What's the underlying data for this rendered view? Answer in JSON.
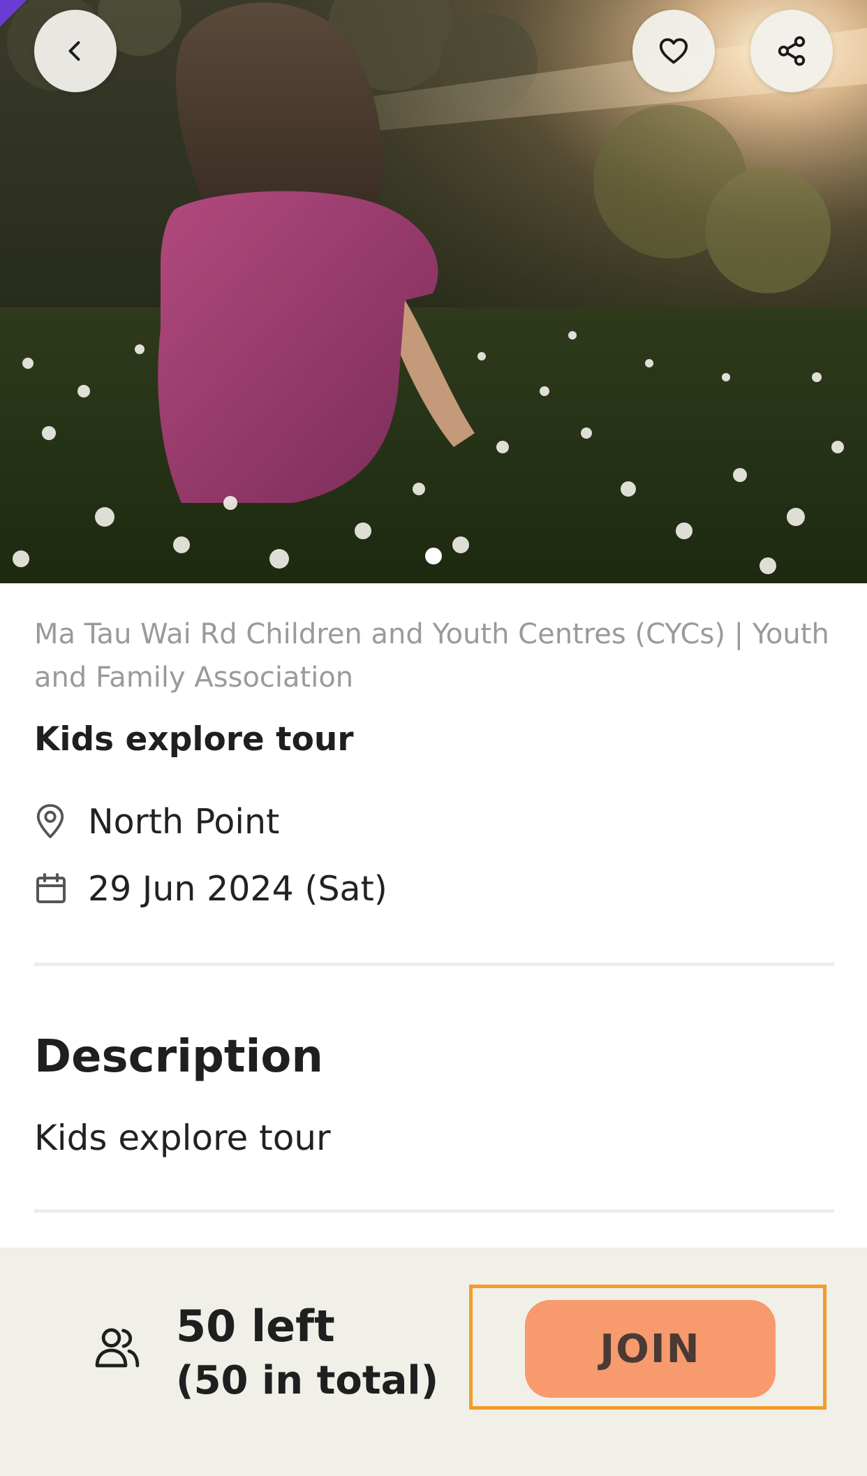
{
  "hero": {
    "image_alt": "Child sitting in a field of daisies at sunset",
    "carousel_page": 1,
    "carousel_total": 1
  },
  "header_actions": {
    "back_icon": "chevron-left-icon",
    "favorite_icon": "heart-outline-icon",
    "share_icon": "share-icon"
  },
  "event": {
    "organizer": "Ma Tau Wai Rd Children and Youth Centres (CYCs) | Youth and Family Association",
    "title": "Kids explore tour",
    "location": "North Point",
    "date": "29 Jun 2024 (Sat)",
    "location_icon": "map-pin-icon",
    "date_icon": "calendar-icon"
  },
  "description": {
    "heading": "Description",
    "body": "Kids explore tour"
  },
  "bottom_bar": {
    "people_icon": "people-icon",
    "quota_left": "50 left",
    "quota_total": "(50 in total)",
    "join_label": "JOIN"
  },
  "colors": {
    "accent_purple": "#6b3bd6",
    "join_button": "#f79a6d",
    "join_outline": "#f59b2a",
    "bottom_bar_bg": "#f1f0e8",
    "organizer_text": "#9a9a9a"
  }
}
